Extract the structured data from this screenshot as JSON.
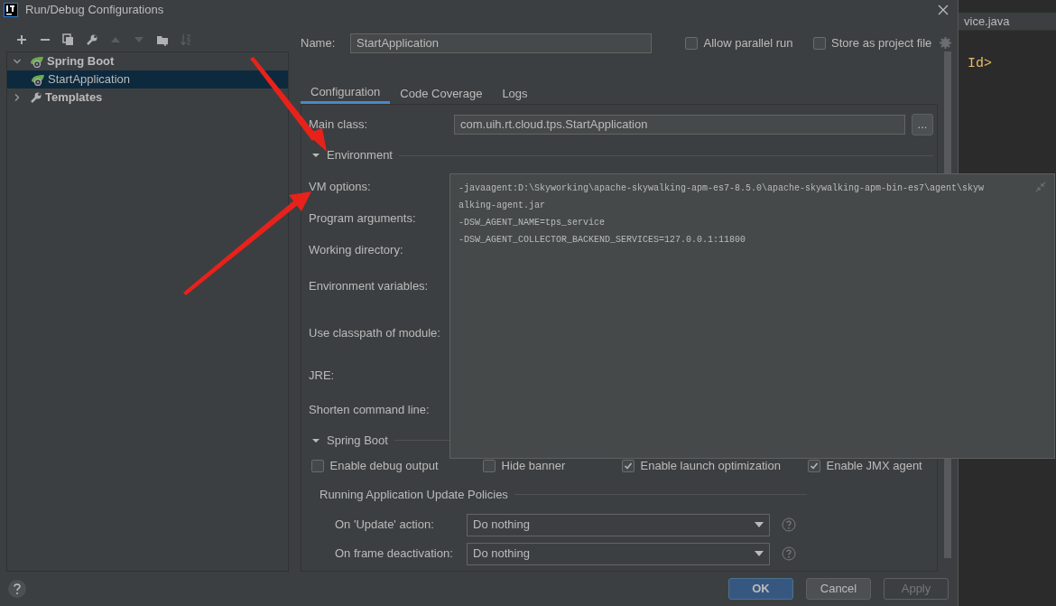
{
  "window": {
    "title": "Run/Debug Configurations"
  },
  "toolbar": [
    {
      "kind": "add",
      "disabled": false
    },
    {
      "kind": "remove",
      "disabled": false
    },
    {
      "kind": "copy",
      "disabled": false
    },
    {
      "kind": "wrench",
      "disabled": false
    },
    {
      "kind": "up",
      "disabled": true
    },
    {
      "kind": "down",
      "disabled": true
    },
    {
      "kind": "folder",
      "disabled": false
    },
    {
      "kind": "sort",
      "disabled": true
    }
  ],
  "tree": [
    {
      "label": "Spring Boot",
      "kind": "spring",
      "expanded": true,
      "selected": false,
      "children": [
        {
          "label": "StartApplication",
          "selected": true
        }
      ]
    },
    {
      "label": "Templates",
      "kind": "templates",
      "expanded": false,
      "selected": false
    }
  ],
  "name": {
    "label": "Name:",
    "value": "StartApplication"
  },
  "options": [
    {
      "label": "Allow parallel run",
      "checked": false
    },
    {
      "label": "Store as project file",
      "checked": false
    }
  ],
  "tabs": [
    {
      "label": "Configuration",
      "selected": true
    },
    {
      "label": "Code Coverage",
      "selected": false
    },
    {
      "label": "Logs",
      "selected": false
    }
  ],
  "form": [
    {
      "kind": "field",
      "label": "Main class:",
      "value": "com.uih.rt.cloud.tps.StartApplication",
      "button": "..."
    },
    {
      "kind": "section",
      "label": "Environment",
      "expanded": true
    },
    {
      "kind": "label",
      "label": "VM options:"
    },
    {
      "kind": "label",
      "label": "Program arguments:"
    },
    {
      "kind": "label",
      "label": "Working directory:"
    },
    {
      "kind": "label",
      "label": "Environment variables:"
    },
    {
      "kind": "label",
      "label": "Use classpath of module:"
    },
    {
      "kind": "label",
      "label": "JRE:"
    },
    {
      "kind": "label",
      "label": "Shorten command line:"
    },
    {
      "kind": "section",
      "label": "Spring Boot",
      "expanded": true
    },
    {
      "kind": "checks",
      "items": [
        {
          "label": "Enable debug output",
          "checked": false
        },
        {
          "label": "Hide banner",
          "checked": false
        },
        {
          "label": "Enable launch optimization",
          "checked": true
        },
        {
          "label": "Enable JMX agent",
          "checked": true
        }
      ]
    },
    {
      "kind": "group",
      "label": "Running Application Update Policies"
    },
    {
      "kind": "select",
      "label": "On 'Update' action:",
      "value": "Do nothing"
    },
    {
      "kind": "select",
      "label": "On frame deactivation:",
      "value": "Do nothing"
    }
  ],
  "vm_popup": {
    "lines": [
      "-javaagent:D:\\Skyworking\\apache-skywalking-apm-es7-8.5.0\\apache-skywalking-apm-bin-es7\\agent\\skyw",
      "alking-agent.jar",
      "-DSW_AGENT_NAME=tps_service",
      "-DSW_AGENT_COLLECTOR_BACKEND_SERVICES=127.0.0.1:11800"
    ]
  },
  "buttons": [
    {
      "label": "OK",
      "kind": "primary",
      "disabled": false
    },
    {
      "label": "Cancel",
      "kind": "default",
      "disabled": false
    },
    {
      "label": "Apply",
      "kind": "default",
      "disabled": true
    }
  ],
  "editor": {
    "tab": "vice.java",
    "code": "Id>"
  }
}
